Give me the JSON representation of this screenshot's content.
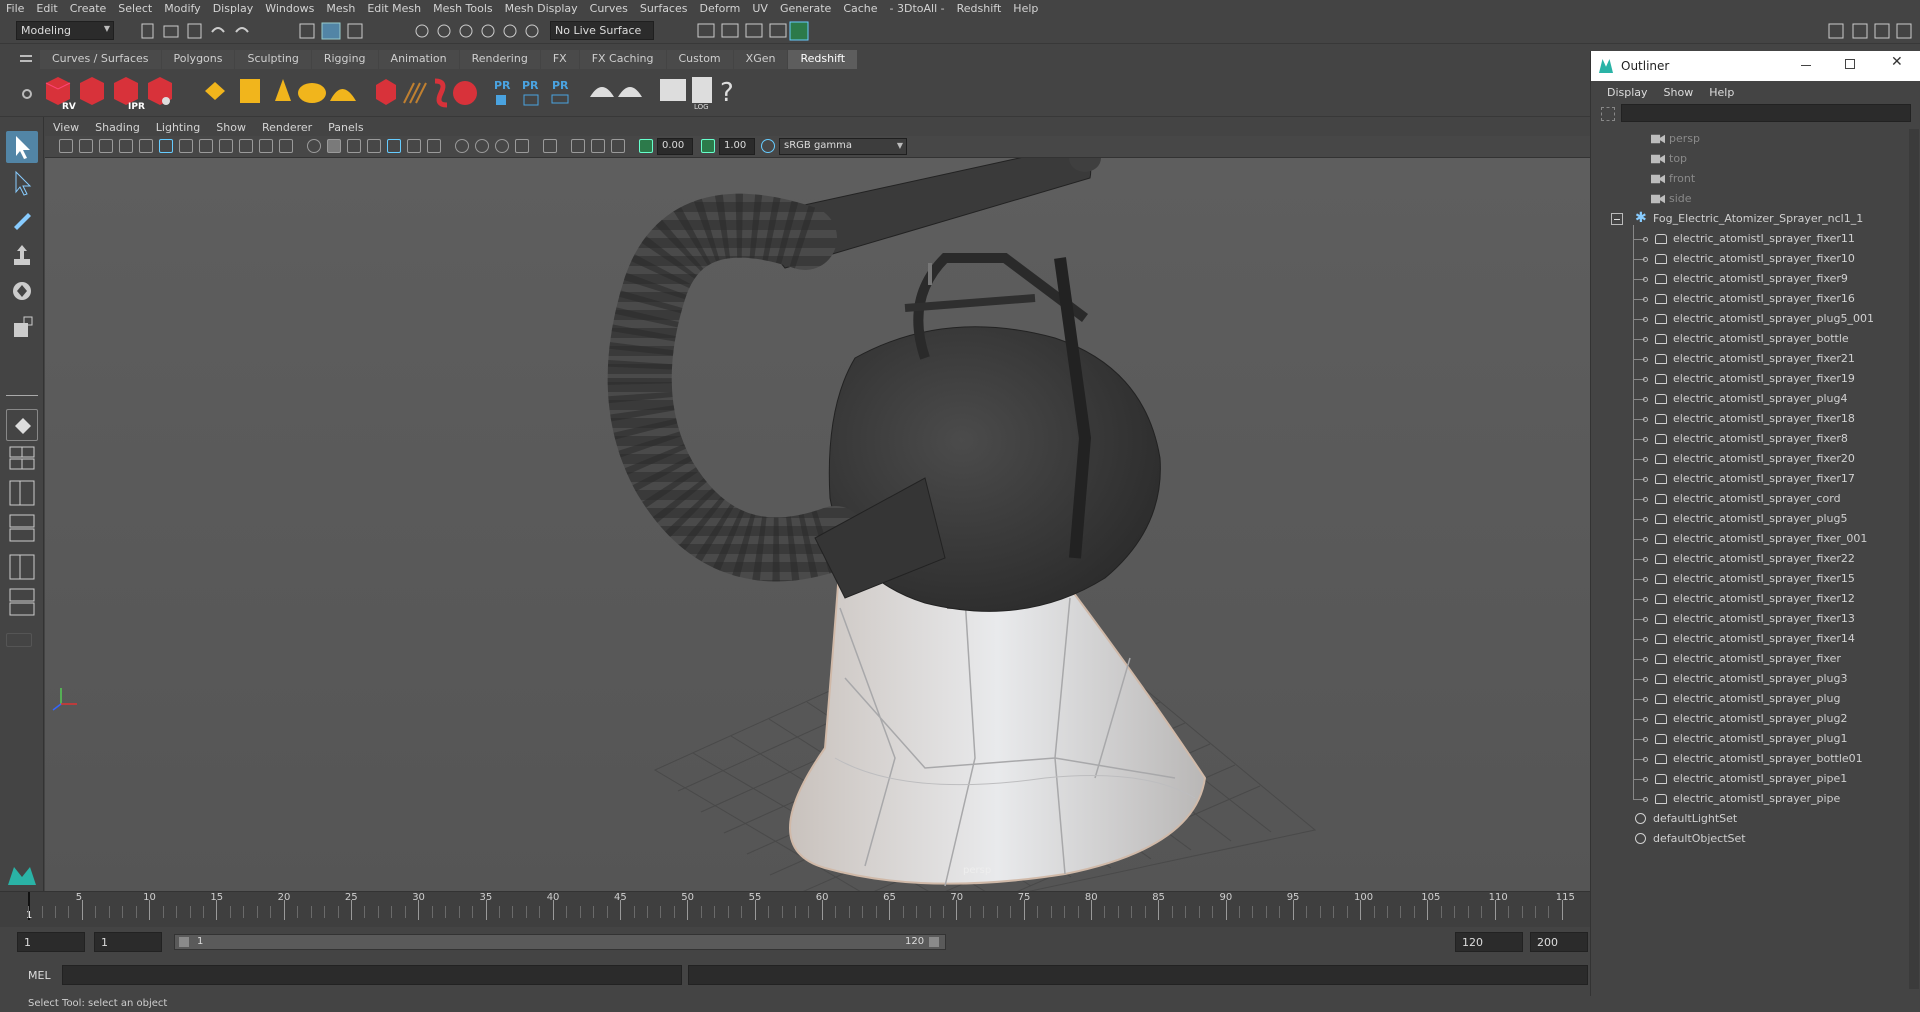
{
  "menubar": [
    "File",
    "Edit",
    "Create",
    "Select",
    "Modify",
    "Display",
    "Windows",
    "Mesh",
    "Edit Mesh",
    "Mesh Tools",
    "Mesh Display",
    "Curves",
    "Surfaces",
    "Deform",
    "UV",
    "Generate",
    "Cache",
    "- 3DtoAll -",
    "Redshift",
    "Help"
  ],
  "status": {
    "workspace": "Modeling",
    "live_surface": "No Live Surface"
  },
  "shelf_tabs": [
    "Curves / Surfaces",
    "Polygons",
    "Sculpting",
    "Rigging",
    "Animation",
    "Rendering",
    "FX",
    "FX Caching",
    "Custom",
    "XGen",
    "Redshift"
  ],
  "shelf_active": "Redshift",
  "shelf_labels": {
    "rv": "RV",
    "ipr": "IPR",
    "pr": "PR",
    "log": "LOG",
    "help": "?"
  },
  "panel_menu": [
    "View",
    "Shading",
    "Lighting",
    "Show",
    "Renderer",
    "Panels"
  ],
  "panel_tools": {
    "exposure": "0.00",
    "gamma": "1.00",
    "colorspace": "sRGB gamma"
  },
  "viewport": {
    "camera_label": "persp"
  },
  "timeslider": {
    "ticks": [
      "5",
      "10",
      "15",
      "20",
      "25",
      "30",
      "35",
      "40",
      "45",
      "50",
      "55",
      "60",
      "65",
      "70",
      "75",
      "80",
      "85",
      "90",
      "95",
      "100",
      "105",
      "110",
      "115"
    ],
    "current_frame": "1"
  },
  "range": {
    "start": "1",
    "playback_start": "1",
    "slider_start": "1",
    "slider_end": "120",
    "playback_end": "120",
    "end": "200"
  },
  "cmdline": {
    "label": "MEL"
  },
  "helpline": "Select Tool: select an object",
  "outliner": {
    "title": "Outliner",
    "menu": [
      "Display",
      "Show",
      "Help"
    ],
    "cameras": [
      "persp",
      "top",
      "front",
      "side"
    ],
    "group": "Fog_Electric_Atomizer_Sprayer_ncl1_1",
    "children": [
      "electric_atomistl_sprayer_fixer11",
      "electric_atomistl_sprayer_fixer10",
      "electric_atomistl_sprayer_fixer9",
      "electric_atomistl_sprayer_fixer16",
      "electric_atomistl_sprayer_plug5_001",
      "electric_atomistl_sprayer_bottle",
      "electric_atomistl_sprayer_fixer21",
      "electric_atomistl_sprayer_fixer19",
      "electric_atomistl_sprayer_plug4",
      "electric_atomistl_sprayer_fixer18",
      "electric_atomistl_sprayer_fixer8",
      "electric_atomistl_sprayer_fixer20",
      "electric_atomistl_sprayer_fixer17",
      "electric_atomistl_sprayer_cord",
      "electric_atomistl_sprayer_plug5",
      "electric_atomistl_sprayer_fixer_001",
      "electric_atomistl_sprayer_fixer22",
      "electric_atomistl_sprayer_fixer15",
      "electric_atomistl_sprayer_fixer12",
      "electric_atomistl_sprayer_fixer13",
      "electric_atomistl_sprayer_fixer14",
      "electric_atomistl_sprayer_fixer",
      "electric_atomistl_sprayer_plug3",
      "electric_atomistl_sprayer_plug",
      "electric_atomistl_sprayer_plug2",
      "electric_atomistl_sprayer_plug1",
      "electric_atomistl_sprayer_bottle01",
      "electric_atomistl_sprayer_pipe1",
      "electric_atomistl_sprayer_pipe"
    ],
    "sets": [
      "defaultLightSet",
      "defaultObjectSet"
    ]
  },
  "colors": {
    "accent": "#5285a6",
    "redshift_red": "#d8323a",
    "gold": "#f1b51c",
    "active_tool": "#5285a6"
  }
}
